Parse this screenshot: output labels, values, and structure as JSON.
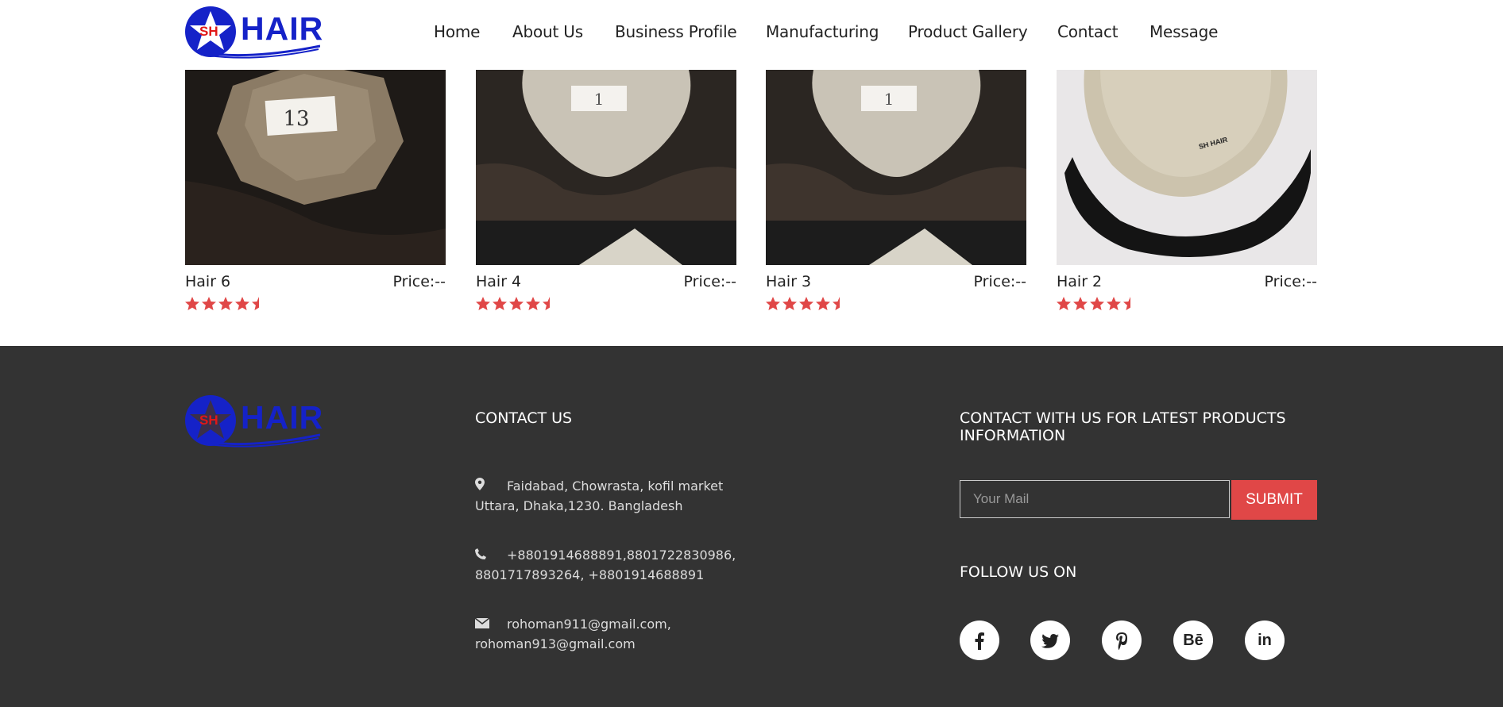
{
  "nav": {
    "logo_sh": "SH",
    "logo_word": "HAIR",
    "items": [
      "Home",
      "About Us",
      "Business Profile",
      "Manufacturing",
      "Product Gallery",
      "Contact",
      "Message"
    ]
  },
  "products": [
    {
      "name": "Hair 6",
      "price": "Price:--",
      "tag": "13",
      "rating": 4.5
    },
    {
      "name": "Hair 4",
      "price": "Price:--",
      "tag": "1",
      "rating": 4.5
    },
    {
      "name": "Hair 3",
      "price": "Price:--",
      "tag": "1",
      "rating": 4.5
    },
    {
      "name": "Hair 2",
      "price": "Price:--",
      "tag": "",
      "rating": 4.5
    }
  ],
  "footer": {
    "logo_sh": "SH",
    "logo_word": "HAIR",
    "contact_heading": "CONTACT US",
    "address_line1": "Faidabad, Chowrasta, kofil market",
    "address_line2": "Uttara, Dhaka,1230. Bangladesh",
    "phone_line1": "+8801914688891,8801722830986,",
    "phone_line2": "8801717893264, +8801914688891",
    "email_line1": "rohoman911@gmail.com,",
    "email_line2": "rohoman913@gmail.com",
    "newsletter_heading_line1": "CONTACT WITH US FOR LATEST PRODUCTS",
    "newsletter_heading_line2": "INFORMATION",
    "mail_placeholder": "Your Mail",
    "submit_label": "SUBMIT",
    "follow_heading": "FOLLOW US ON",
    "social": [
      "f",
      "t",
      "p",
      "Bē",
      "in"
    ]
  },
  "colors": {
    "brand_blue": "#1522c8",
    "accent_red": "#e04747",
    "footer_bg": "#333333"
  }
}
